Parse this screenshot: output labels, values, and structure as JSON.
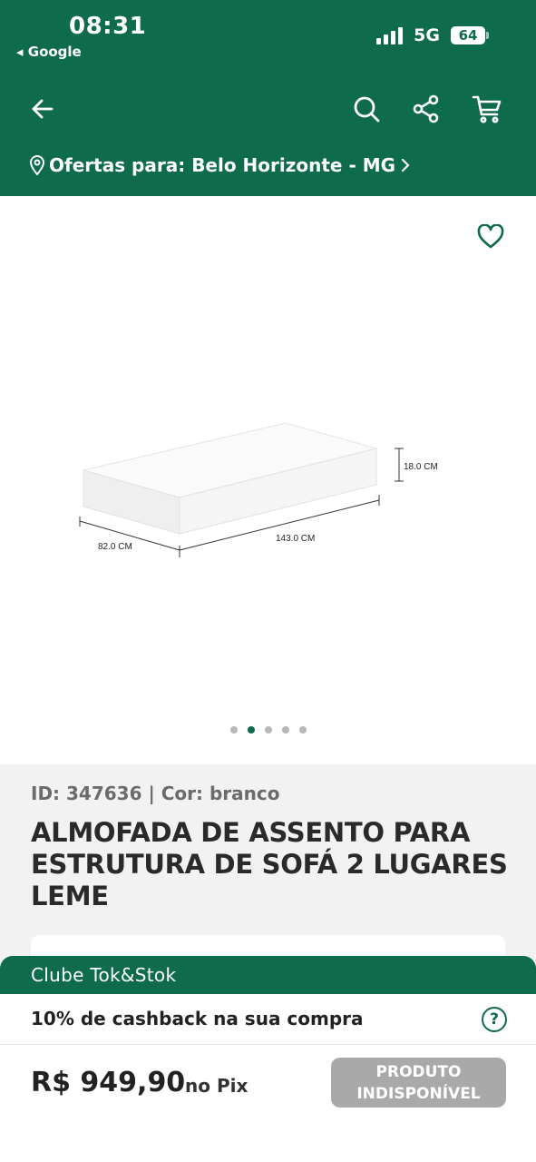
{
  "status_bar": {
    "time": "08:31",
    "back_app": "◂ Google",
    "network": "5G",
    "battery": "64"
  },
  "header": {
    "icons": [
      "back-arrow-icon",
      "search-icon",
      "share-icon",
      "cart-icon"
    ],
    "location_label": "Ofertas para: Belo Horizonte - MG"
  },
  "gallery": {
    "dimensions": {
      "height": "18.0 CM",
      "depth": "82.0 CM",
      "length": "143.0 CM"
    },
    "page_count": 5,
    "active_page": 2
  },
  "product": {
    "meta": "ID: 347636 | Cor: branco",
    "title": "ALMOFADA DE ASSENTO PARA ESTRUTURA DE SOFÁ 2 LUGARES LEME"
  },
  "club": {
    "label": "Clube Tok&Stok",
    "cashback": "10% de cashback na sua compra",
    "help": "?"
  },
  "purchase": {
    "price": "R$ 949,90",
    "price_suffix": "no Pix",
    "status_line1": "PRODUTO",
    "status_line2": "INDISPONÍVEL"
  },
  "colors": {
    "brand": "#0e6b4c",
    "disabled": "#a9a9a9"
  }
}
